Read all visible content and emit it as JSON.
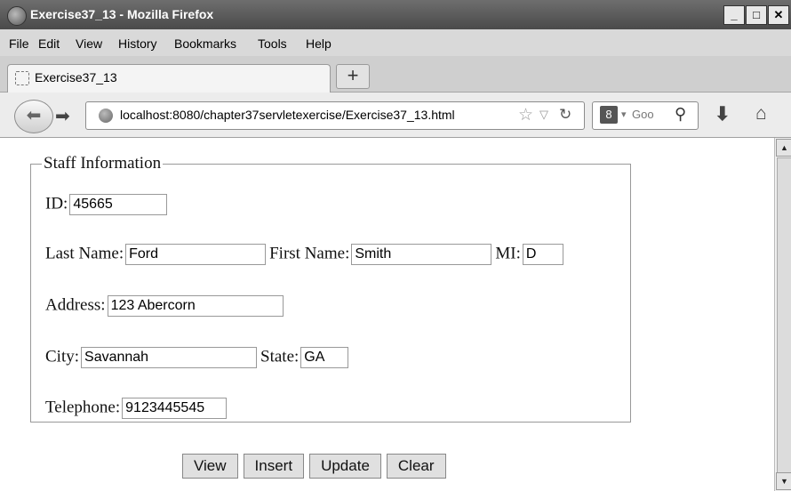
{
  "window": {
    "title": "Exercise37_13 - Mozilla Firefox",
    "minimize": "_",
    "maximize": "□",
    "close": "✕"
  },
  "menu": [
    "File",
    "Edit",
    "View",
    "History",
    "Bookmarks",
    "Tools",
    "Help"
  ],
  "tab": {
    "label": "Exercise37_13",
    "new_tab": "+"
  },
  "nav": {
    "url": "localhost:8080/chapter37servletexercise/Exercise37_13.html",
    "search_placeholder": "Goo",
    "search_engine": "8",
    "icons": [
      "back-icon",
      "forward-icon",
      "globe-icon",
      "bookmark-star-icon",
      "history-dropdown-icon",
      "reload-icon",
      "search-icon",
      "download-icon",
      "home-icon"
    ]
  },
  "form": {
    "legend": "Staff Information",
    "id_label": "ID:",
    "id_value": "45665",
    "last_name_label": "Last Name:",
    "last_name_value": "Ford",
    "first_name_label": "First Name:",
    "first_name_value": "Smith",
    "mi_label": "MI:",
    "mi_value": "D",
    "address_label": "Address:",
    "address_value": "123 Abercorn",
    "city_label": "City:",
    "city_value": "Savannah",
    "state_label": "State:",
    "state_value": "GA",
    "telephone_label": "Telephone:",
    "telephone_value": "9123445545"
  },
  "buttons": {
    "view": "View",
    "insert": "Insert",
    "update": "Update",
    "clear": "Clear"
  }
}
